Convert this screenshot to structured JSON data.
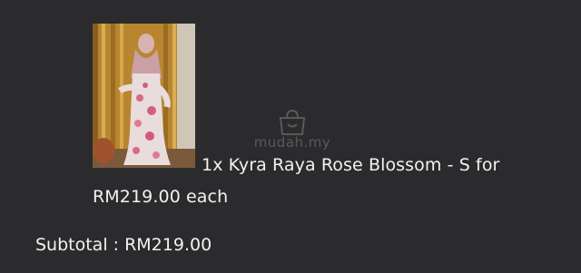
{
  "order": {
    "item": {
      "description": "1x Kyra Raya Rose Blossom - S for",
      "price_line": "RM219.00 each"
    },
    "subtotal": "Subtotal : RM219.00"
  },
  "watermark": {
    "text": "mudah.my",
    "icon": "shopping-bag-icon"
  },
  "colors": {
    "background": "#2b2b2d",
    "text": "#f2f2f2",
    "curtain": "#c99a3d"
  }
}
